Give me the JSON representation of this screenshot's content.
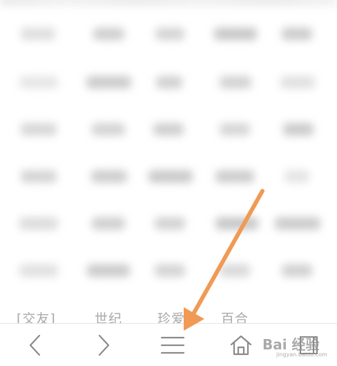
{
  "site_links": [
    "[交友]",
    "世纪",
    "珍爱",
    "百合"
  ],
  "toolbar": {
    "back": "back-chevron",
    "forward": "forward-chevron",
    "menu": "hamburger-menu",
    "home": "home",
    "tabs": "tabs-window"
  },
  "annotation": {
    "arrow_color": "#f09a55",
    "points_to": "menu-button"
  },
  "watermark": {
    "main": "Bai 经验",
    "sub": "jingyan.baidu.com"
  },
  "colors": {
    "icon": "#8a8a8a",
    "link_text": "#a9a9a9",
    "arrow": "#f09a55"
  }
}
